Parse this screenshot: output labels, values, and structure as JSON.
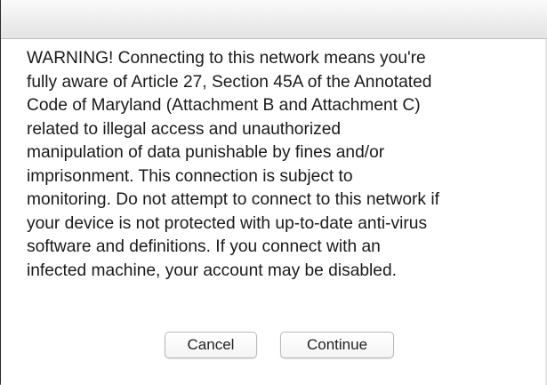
{
  "dialog": {
    "message_lines": [
      "WARNING! Connecting to this network means you're",
      "fully aware of Article 27, Section 45A of the Annotated",
      "Code of Maryland (Attachment B and Attachment C)",
      "related to illegal access and unauthorized",
      "manipulation of data punishable by fines and/or",
      "imprisonment. This connection is subject to",
      "monitoring. Do not attempt to connect to this network if",
      "your device is not protected with up-to-date anti-virus",
      "software and definitions. If you connect with an",
      "infected machine, your account may be disabled."
    ],
    "buttons": {
      "cancel_label": "Cancel",
      "continue_label": "Continue"
    }
  }
}
